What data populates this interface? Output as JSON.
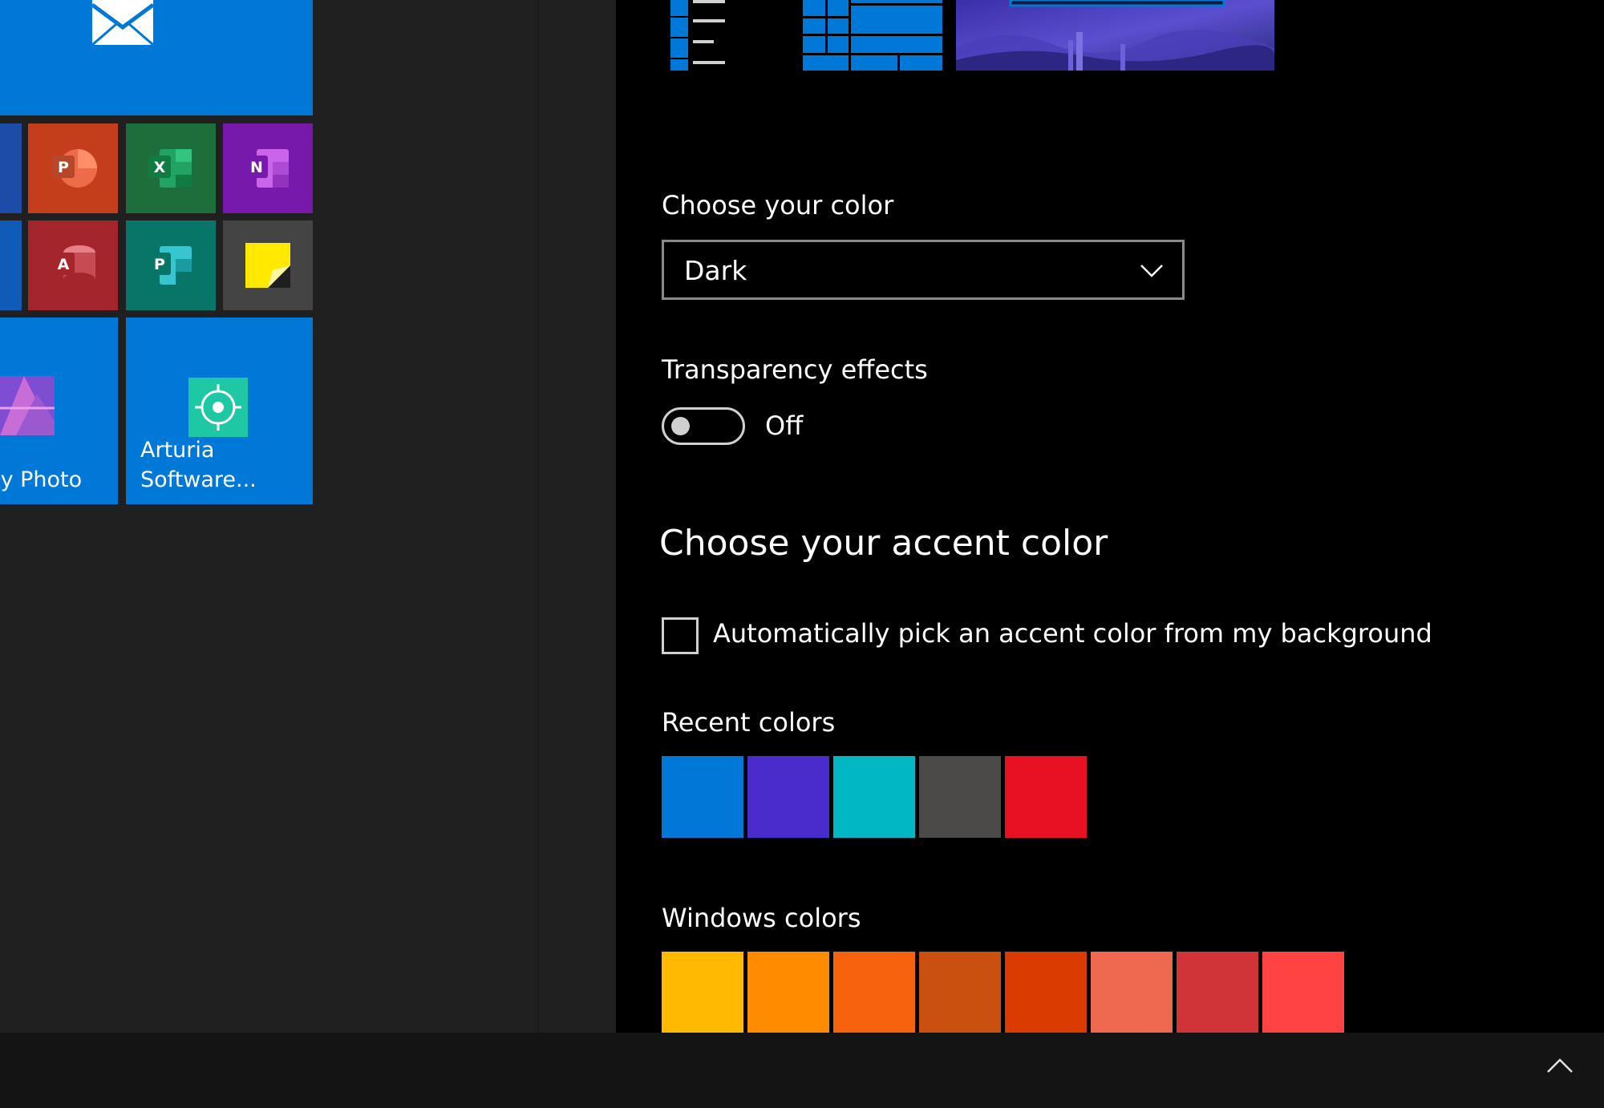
{
  "colors": {
    "start_bg": "#202020",
    "settings_bg": "#000000",
    "taskbar_bg": "#141414",
    "tile_blue": "#0078d7"
  },
  "start_menu": {
    "tiles": {
      "mail": {
        "icon": "mail-icon",
        "color": "#0078d7"
      },
      "word_partial": {
        "icon": "word-icon",
        "color": "#1c4ba8"
      },
      "powerpoint": {
        "icon": "powerpoint-icon",
        "letter": "P",
        "color": "#c43e1c"
      },
      "excel": {
        "icon": "excel-icon",
        "letter": "X",
        "color": "#1e6e3c"
      },
      "onenote": {
        "icon": "onenote-icon",
        "letter": "N",
        "color": "#7719aa"
      },
      "outlook_partial": {
        "icon": "outlook-icon",
        "color": "#0f5bb5"
      },
      "access": {
        "icon": "access-icon",
        "letter": "A",
        "color": "#a4262c"
      },
      "publisher": {
        "icon": "publisher-icon",
        "letter": "P",
        "color": "#077568"
      },
      "sticky_notes": {
        "icon": "sticky-notes-icon",
        "color": "#444444"
      },
      "affinity_photo": {
        "label": "ty Photo",
        "icon": "affinity-photo-icon",
        "color": "#0078d7"
      },
      "arturia": {
        "label": "Arturia\nSoftware...",
        "icon": "arturia-icon",
        "color": "#0078d7"
      }
    }
  },
  "settings": {
    "choose_color": {
      "label": "Choose your color",
      "selected": "Dark"
    },
    "transparency": {
      "label": "Transparency effects",
      "state": "Off"
    },
    "accent": {
      "heading": "Choose your accent color",
      "auto_pick_label": "Automatically pick an accent color from my background",
      "auto_pick_checked": false
    },
    "recent_colors": {
      "label": "Recent colors",
      "swatches": [
        "#0078d7",
        "#4a2bcc",
        "#00b7c3",
        "#4c4a48",
        "#e81123"
      ]
    },
    "windows_colors": {
      "label": "Windows colors",
      "swatches": [
        "#ffb900",
        "#ff8c00",
        "#f7630c",
        "#ca5010",
        "#da3b01",
        "#ef6950",
        "#d13438",
        "#ff4343"
      ]
    }
  },
  "taskbar": {
    "show_hidden_icon": "chevron-up-icon"
  }
}
